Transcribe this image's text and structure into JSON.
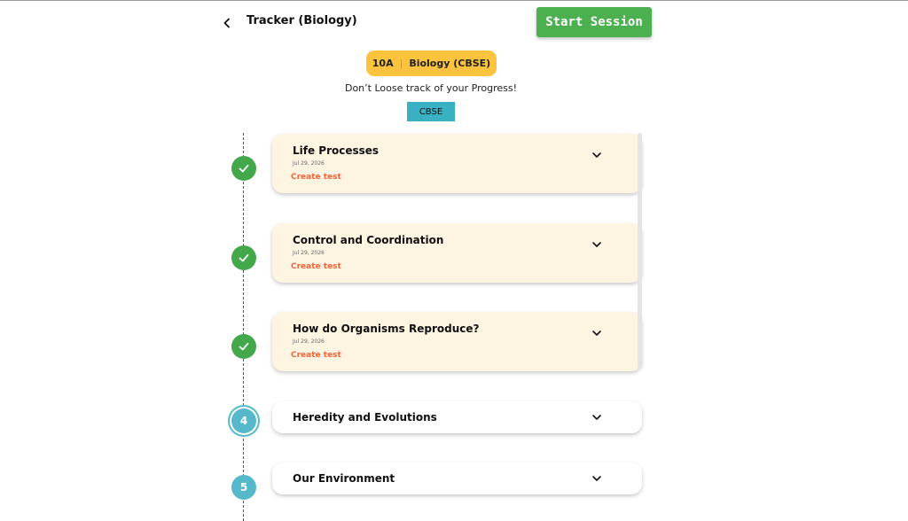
{
  "header": {
    "title": "Tracker (Biology)",
    "start_label": "Start Session",
    "back_icon": "chevron-left-icon"
  },
  "badge": {
    "grade": "10A",
    "separator": "|",
    "subject": "Biology (CBSE)"
  },
  "subtitle": "Don’t Loose track of your Progress!",
  "board_tag": "CBSE",
  "colors": {
    "accent_green": "#4caf50",
    "done_marker": "#43a84a",
    "pending_marker": "#56b9cb",
    "badge_yellow": "#fcc43e",
    "board_teal": "#3ab0c3",
    "link_orange": "#f2643a",
    "done_card_bg": "#fdf5e2"
  },
  "chapters": [
    {
      "title": "Life Processes",
      "date": "Jul 29, 2026",
      "action": "Create test",
      "status": "done",
      "marker_icon": "check-icon"
    },
    {
      "title": "Control and Coordination",
      "date": "Jul 29, 2026",
      "action": "Create test",
      "status": "done",
      "marker_icon": "check-icon"
    },
    {
      "title": "How do Organisms Reproduce?",
      "date": "Jul 29, 2026",
      "action": "Create test",
      "status": "done",
      "marker_icon": "check-icon"
    },
    {
      "title": "Heredity and Evolutions",
      "number": "4",
      "status": "current"
    },
    {
      "title": "Our Environment",
      "number": "5",
      "status": "pending"
    }
  ]
}
